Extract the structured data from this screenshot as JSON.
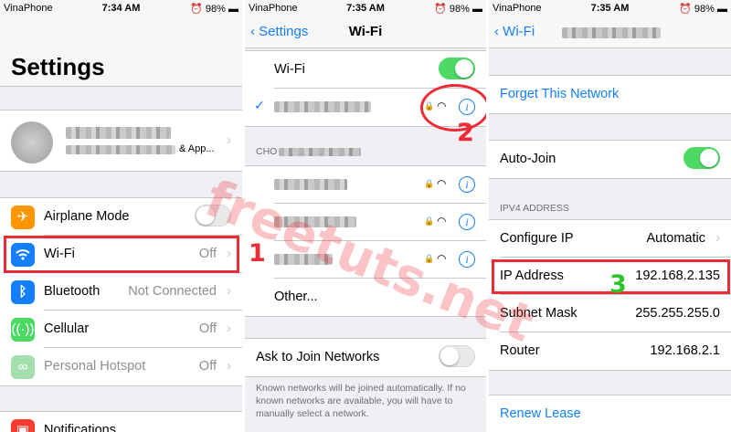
{
  "colors": {
    "accent": "#147efb",
    "toggle_on": "#4cd964",
    "highlight": "#ec2b34",
    "marker_3": "#2ec52a"
  },
  "status_bars": [
    {
      "carrier": "VinaPhone",
      "time": "7:34 AM",
      "battery": "98%"
    },
    {
      "carrier": "VinaPhone",
      "time": "7:35 AM",
      "battery": "98%"
    },
    {
      "carrier": "VinaPhone",
      "time": "7:35 AM",
      "battery": "98%"
    }
  ],
  "settings": {
    "title": "Settings",
    "profile_suffix": "& App...",
    "items": [
      {
        "label": "Airplane Mode",
        "icon": "airplane-icon",
        "toggle": "off"
      },
      {
        "label": "Wi-Fi",
        "icon": "wifi-icon",
        "value": "Off"
      },
      {
        "label": "Bluetooth",
        "icon": "bluetooth-icon",
        "value": "Not Connected"
      },
      {
        "label": "Cellular",
        "icon": "cellular-icon",
        "value": "Off"
      },
      {
        "label": "Personal Hotspot",
        "icon": "hotspot-icon",
        "value": "Off"
      }
    ],
    "notifications": "Notifications"
  },
  "wifi": {
    "back": "Settings",
    "title": "Wi-Fi",
    "wifi_label": "Wi-Fi",
    "choose_header": "CHO",
    "other": "Other...",
    "ask_label": "Ask to Join Networks",
    "footnote": "Known networks will be joined automatically. If no known networks are available, you will have to manually select a network."
  },
  "network": {
    "back": "Wi-Fi",
    "forget": "Forget This Network",
    "auto_join": "Auto-Join",
    "ipv4_header": "IPV4 ADDRESS",
    "configure_ip_label": "Configure IP",
    "configure_ip_value": "Automatic",
    "ip_label": "IP Address",
    "ip_value": "192.168.2.135",
    "subnet_label": "Subnet Mask",
    "subnet_value": "255.255.255.0",
    "router_label": "Router",
    "router_value": "192.168.2.1",
    "renew": "Renew Lease"
  },
  "annotations": {
    "one": "1",
    "two": "2",
    "three": "3"
  },
  "watermark": "freetuts.net"
}
